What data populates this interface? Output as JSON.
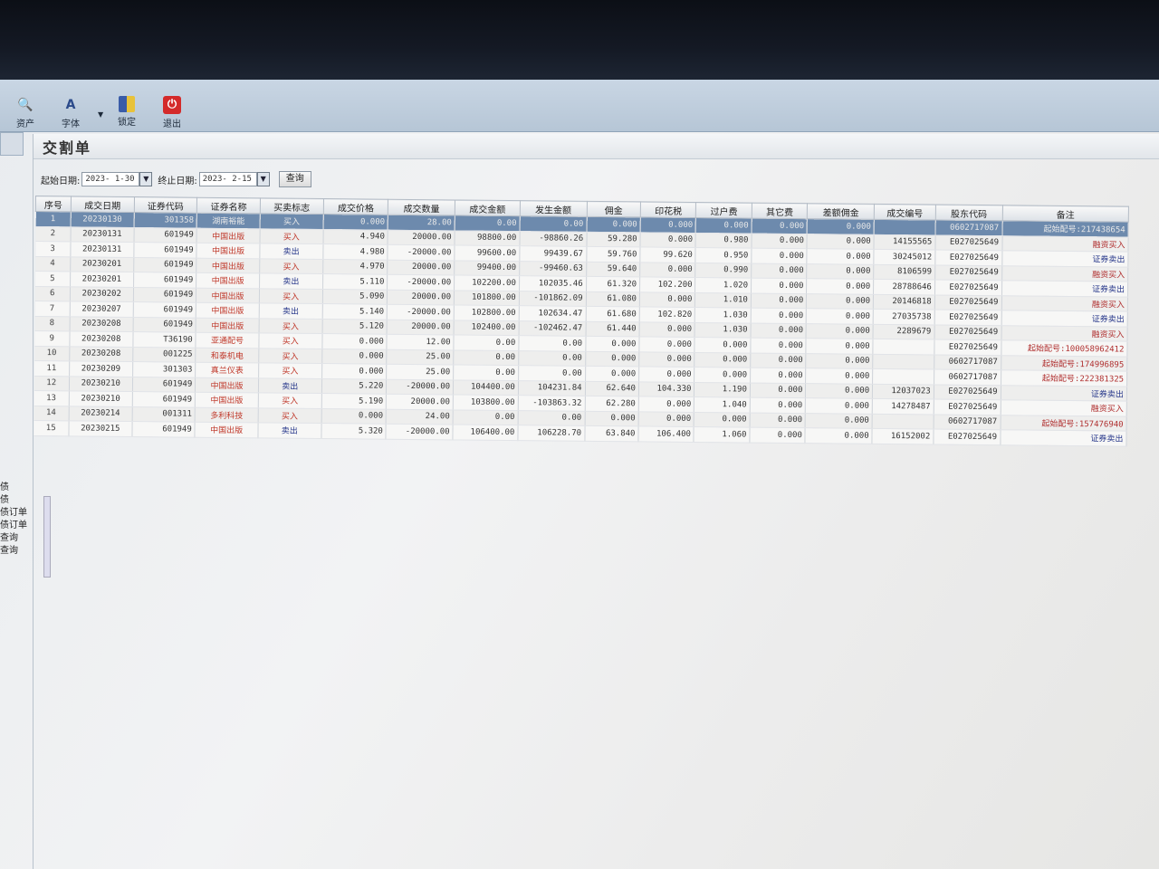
{
  "toolbar": {
    "assets_label": "资产",
    "font_label": "字体",
    "lock_label": "锁定",
    "exit_label": "退出"
  },
  "panel": {
    "title": "交割单",
    "start_label": "起始日期:",
    "start_value": "2023- 1-30",
    "end_label": "终止日期:",
    "end_value": "2023- 2-15",
    "query_label": "查询"
  },
  "left_menu": [
    "债",
    "债",
    "债订单",
    "债订单",
    "查询",
    "查询"
  ],
  "table": {
    "headers": [
      "序号",
      "成交日期",
      "证券代码",
      "证券名称",
      "买卖标志",
      "成交价格",
      "成交数量",
      "成交金额",
      "发生金额",
      "佣金",
      "印花税",
      "过户费",
      "其它费",
      "差额佣金",
      "成交编号",
      "股东代码",
      "备注"
    ],
    "rows": [
      [
        "1",
        "20230130",
        "301358",
        "湖南裕能",
        "买入",
        "0.000",
        "28.00",
        "0.00",
        "0.00",
        "0.000",
        "0.000",
        "0.000",
        "0.000",
        "0.000",
        "",
        "0602717087",
        "起始配号:217438654"
      ],
      [
        "2",
        "20230131",
        "601949",
        "中国出版",
        "买入",
        "4.940",
        "20000.00",
        "98800.00",
        "-98860.26",
        "59.280",
        "0.000",
        "0.980",
        "0.000",
        "0.000",
        "14155565",
        "E027025649",
        "融资买入"
      ],
      [
        "3",
        "20230131",
        "601949",
        "中国出版",
        "卖出",
        "4.980",
        "-20000.00",
        "99600.00",
        "99439.67",
        "59.760",
        "99.620",
        "0.950",
        "0.000",
        "0.000",
        "30245012",
        "E027025649",
        "证券卖出"
      ],
      [
        "4",
        "20230201",
        "601949",
        "中国出版",
        "买入",
        "4.970",
        "20000.00",
        "99400.00",
        "-99460.63",
        "59.640",
        "0.000",
        "0.990",
        "0.000",
        "0.000",
        "8106599",
        "E027025649",
        "融资买入"
      ],
      [
        "5",
        "20230201",
        "601949",
        "中国出版",
        "卖出",
        "5.110",
        "-20000.00",
        "102200.00",
        "102035.46",
        "61.320",
        "102.200",
        "1.020",
        "0.000",
        "0.000",
        "28788646",
        "E027025649",
        "证券卖出"
      ],
      [
        "6",
        "20230202",
        "601949",
        "中国出版",
        "买入",
        "5.090",
        "20000.00",
        "101800.00",
        "-101862.09",
        "61.080",
        "0.000",
        "1.010",
        "0.000",
        "0.000",
        "20146818",
        "E027025649",
        "融资买入"
      ],
      [
        "7",
        "20230207",
        "601949",
        "中国出版",
        "卖出",
        "5.140",
        "-20000.00",
        "102800.00",
        "102634.47",
        "61.680",
        "102.820",
        "1.030",
        "0.000",
        "0.000",
        "27035738",
        "E027025649",
        "证券卖出"
      ],
      [
        "8",
        "20230208",
        "601949",
        "中国出版",
        "买入",
        "5.120",
        "20000.00",
        "102400.00",
        "-102462.47",
        "61.440",
        "0.000",
        "1.030",
        "0.000",
        "0.000",
        "2289679",
        "E027025649",
        "融资买入"
      ],
      [
        "9",
        "20230208",
        "T36190",
        "亚通配号",
        "买入",
        "0.000",
        "12.00",
        "0.00",
        "0.00",
        "0.000",
        "0.000",
        "0.000",
        "0.000",
        "0.000",
        "",
        "E027025649",
        "起始配号:100058962412"
      ],
      [
        "10",
        "20230208",
        "001225",
        "和泰机电",
        "买入",
        "0.000",
        "25.00",
        "0.00",
        "0.00",
        "0.000",
        "0.000",
        "0.000",
        "0.000",
        "0.000",
        "",
        "0602717087",
        "起始配号:174996895"
      ],
      [
        "11",
        "20230209",
        "301303",
        "真兰仪表",
        "买入",
        "0.000",
        "25.00",
        "0.00",
        "0.00",
        "0.000",
        "0.000",
        "0.000",
        "0.000",
        "0.000",
        "",
        "0602717087",
        "起始配号:222381325"
      ],
      [
        "12",
        "20230210",
        "601949",
        "中国出版",
        "卖出",
        "5.220",
        "-20000.00",
        "104400.00",
        "104231.84",
        "62.640",
        "104.330",
        "1.190",
        "0.000",
        "0.000",
        "12037023",
        "E027025649",
        "证券卖出"
      ],
      [
        "13",
        "20230210",
        "601949",
        "中国出版",
        "买入",
        "5.190",
        "20000.00",
        "103800.00",
        "-103863.32",
        "62.280",
        "0.000",
        "1.040",
        "0.000",
        "0.000",
        "14278487",
        "E027025649",
        "融资买入"
      ],
      [
        "14",
        "20230214",
        "001311",
        "多利科技",
        "买入",
        "0.000",
        "24.00",
        "0.00",
        "0.00",
        "0.000",
        "0.000",
        "0.000",
        "0.000",
        "0.000",
        "",
        "0602717087",
        "起始配号:157476940"
      ],
      [
        "15",
        "20230215",
        "601949",
        "中国出版",
        "卖出",
        "5.320",
        "-20000.00",
        "106400.00",
        "106228.70",
        "63.840",
        "106.400",
        "1.060",
        "0.000",
        "0.000",
        "16152002",
        "E027025649",
        "证券卖出"
      ]
    ]
  },
  "colors": {
    "buy": "#c0392b",
    "sell": "#2a3a8c",
    "selected_row": "#6d8aad",
    "exit_button": "#d42a2a"
  }
}
